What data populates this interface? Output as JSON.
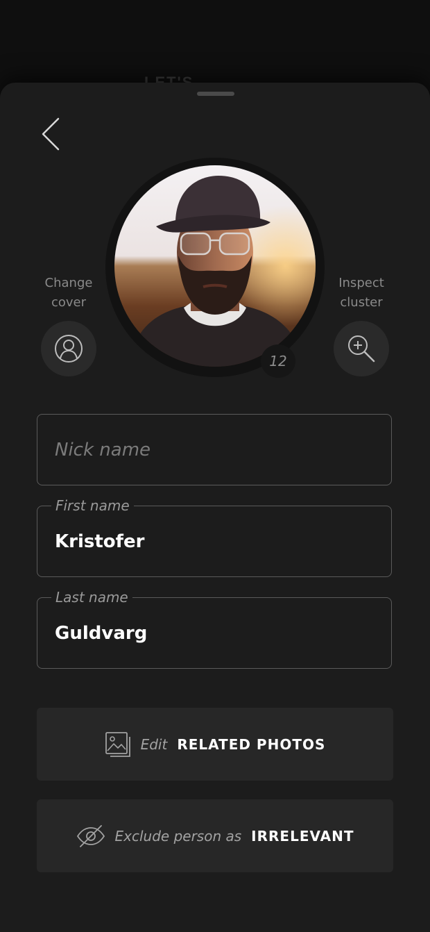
{
  "background": {
    "peek_text": "LET'S"
  },
  "profile": {
    "cluster_count": "12"
  },
  "change_cover": {
    "line1": "Change",
    "line2": "cover",
    "icon": "person-icon"
  },
  "inspect_cluster": {
    "line1": "Inspect",
    "line2": "cluster",
    "icon": "zoom-in-icon"
  },
  "fields": {
    "nick": {
      "placeholder": "Nick name",
      "value": ""
    },
    "first": {
      "label": "First name",
      "value": "Kristofer"
    },
    "last": {
      "label": "Last name",
      "value": "Guldvarg"
    }
  },
  "actions": {
    "edit_photos": {
      "lead": "Edit",
      "strong": "RELATED PHOTOS",
      "icon": "photos-icon"
    },
    "exclude": {
      "lead": "Exclude person as",
      "strong": "IRRELEVANT",
      "icon": "eye-slash-icon"
    }
  },
  "colors": {
    "sheet": "#1c1c1c",
    "button": "#272727",
    "field_border": "#5b5b5b",
    "muted_text": "#8a8a8a"
  }
}
